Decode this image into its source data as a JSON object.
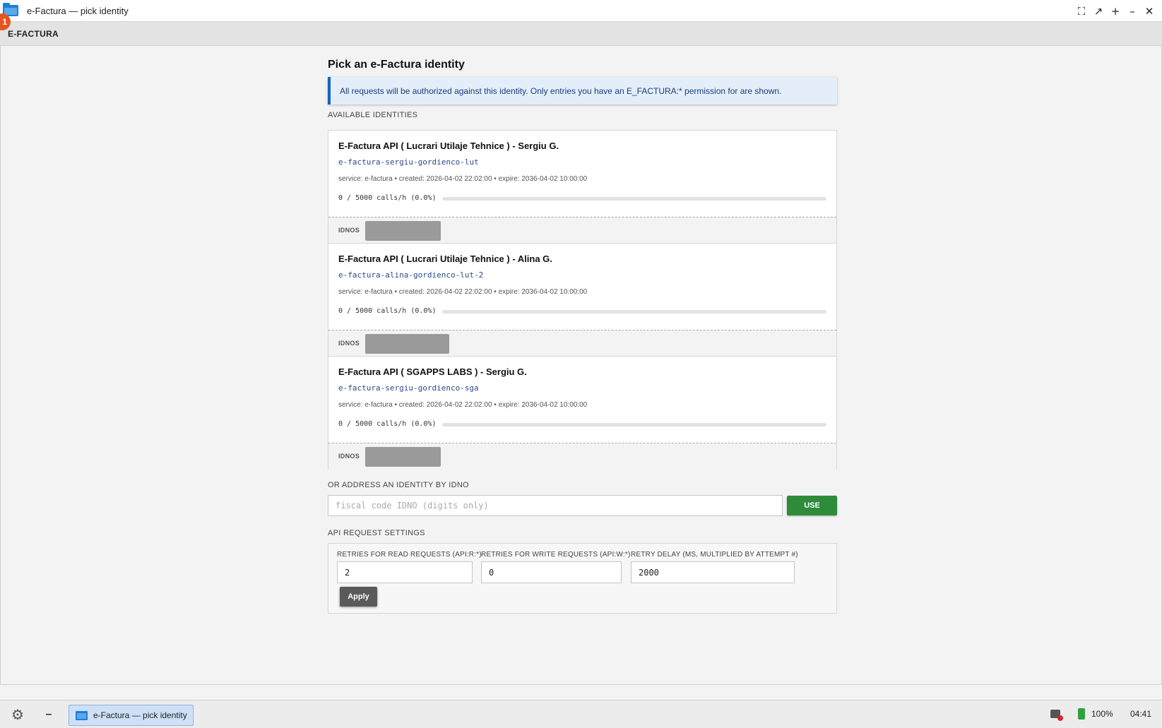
{
  "window": {
    "title": "e-Factura — pick identity",
    "notification_count": "1"
  },
  "app": {
    "brand": "E-FACTURA"
  },
  "page": {
    "title": "Pick an e-Factura identity",
    "info": "All requests will be authorized against this identity. Only entries you have an E_FACTURA:* permission for are shown.",
    "identities_label": "AVAILABLE IDENTITIES",
    "identities": [
      {
        "name": "E-Factura API ( Lucrari Utilaje Tehnice ) - Sergiu G.",
        "slug": "e-factura-sergiu-gordienco-lut",
        "meta": "service: e-factura • created: 2026-04-02 22:02:00 • expire: 2036-04-02 10:00:00",
        "usage": "0 / 5000 calls/h (0.0%)",
        "usage_fraction": 0.0,
        "idnos_label": "IDNOS"
      },
      {
        "name": "E-Factura API ( Lucrari Utilaje Tehnice ) - Alina G.",
        "slug": "e-factura-alina-gordienco-lut-2",
        "meta": "service: e-factura • created: 2026-04-02 22:02:00 • expire: 2036-04-02 10:00:00",
        "usage": "0 / 5000 calls/h (0.0%)",
        "usage_fraction": 0.0,
        "idnos_label": "IDNOS"
      },
      {
        "name": "E-Factura API ( SGAPPS LABS ) - Sergiu G.",
        "slug": "e-factura-sergiu-gordienco-sga",
        "meta": "service: e-factura • created: 2026-04-02 22:02:00 • expire: 2036-04-02 10:00:00",
        "usage": "0 / 5000 calls/h (0.0%)",
        "usage_fraction": 0.0,
        "idnos_label": "IDNOS"
      }
    ],
    "idno_section": {
      "label": "OR ADDRESS AN IDENTITY BY IDNO",
      "placeholder": "fiscal code IDNO (digits only)",
      "value": "",
      "button": "USE"
    },
    "settings": {
      "label": "API REQUEST SETTINGS",
      "read_label": "RETRIES FOR READ REQUESTS (API:R:*)",
      "read_value": "2",
      "write_label": "RETRIES FOR WRITE REQUESTS (API:W:*)",
      "write_value": "0",
      "delay_label": "RETRY DELAY (MS, MULTIPLIED BY ATTEMPT #)",
      "delay_value": "2000",
      "apply": "Apply"
    }
  },
  "taskbar": {
    "task_label": "e-Factura — pick identity",
    "battery": "100%",
    "clock": "04:41"
  },
  "icons": {
    "window_controls": [
      "fullscreen-icon",
      "restore-icon",
      "maximize-icon",
      "minimize-icon",
      "close-icon"
    ],
    "taskbar": [
      "gear-icon",
      "minimize-icon",
      "network-error-icon",
      "battery-icon"
    ]
  },
  "colors": {
    "accent_blue": "#1565c0",
    "use_button": "#2e8b3a",
    "apply_button": "#5a5a5a",
    "badge": "#e8541d"
  }
}
